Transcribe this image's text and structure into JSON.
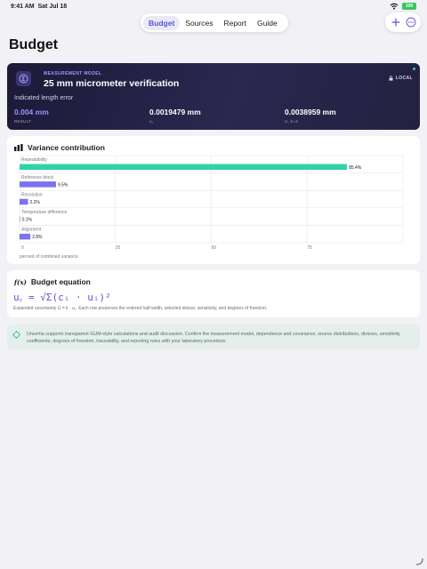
{
  "status_bar": {
    "time": "9:41 AM",
    "date": "Sat Jul 18",
    "battery": "100"
  },
  "nav": {
    "tabs": [
      {
        "label": "Budget",
        "active": true
      },
      {
        "label": "Sources",
        "active": false
      },
      {
        "label": "Report",
        "active": false
      },
      {
        "label": "Guide",
        "active": false
      }
    ],
    "actions": [
      {
        "icon": "plus-icon"
      },
      {
        "icon": "more-icon"
      }
    ]
  },
  "page": {
    "title": "Budget"
  },
  "hero": {
    "kicker": "MEASUREMENT MODEL",
    "title": "25 mm micrometer verification",
    "badge": "LOCAL",
    "subtitle": "Indicated length error",
    "metrics": [
      {
        "value": "0.004 mm",
        "label": "RESULT"
      },
      {
        "value": "0.0019479 mm",
        "label": "u꜀"
      },
      {
        "value": "0.0038959 mm",
        "label": "U, k=2"
      }
    ],
    "accent_color": "#9a94ff"
  },
  "variance": {
    "title": "Variance contribution",
    "chart_data": {
      "type": "bar",
      "orientation": "horizontal",
      "categories": [
        "Repeatability",
        "Reference block",
        "Resolution",
        "Temperature difference",
        "Alignment"
      ],
      "values": [
        85.4,
        9.5,
        2.2,
        0.1,
        2.8
      ],
      "value_labels": [
        "85.4%",
        "9.5%",
        "2.2%",
        "0.1%",
        "2.8%"
      ],
      "colors": [
        "#30d3a8",
        "#7b72f0",
        "#7b72f0",
        "#7b72f0",
        "#7b72f0"
      ],
      "xticks": [
        "0",
        "25",
        "50",
        "75"
      ],
      "xlim": [
        0,
        100
      ],
      "xlabel": "percent of combined variance",
      "grid": true
    }
  },
  "equation": {
    "title": "Budget equation",
    "formula": "u꜀ = √Σ(cᵢ · uᵢ)²",
    "note": "Expanded uncertainty U = k · u꜀. Each row preserves the entered half-width, selected divisor, sensitivity, and degrees of freedom."
  },
  "info": {
    "text": "Uncertia supports transparent GUM-style calculations and audit discussion. Confirm the measurement model, dependence and covariance, source distributions, divisors, sensitivity coefficients, degrees of freedom, traceability, and reporting rules with your laboratory procedure."
  }
}
